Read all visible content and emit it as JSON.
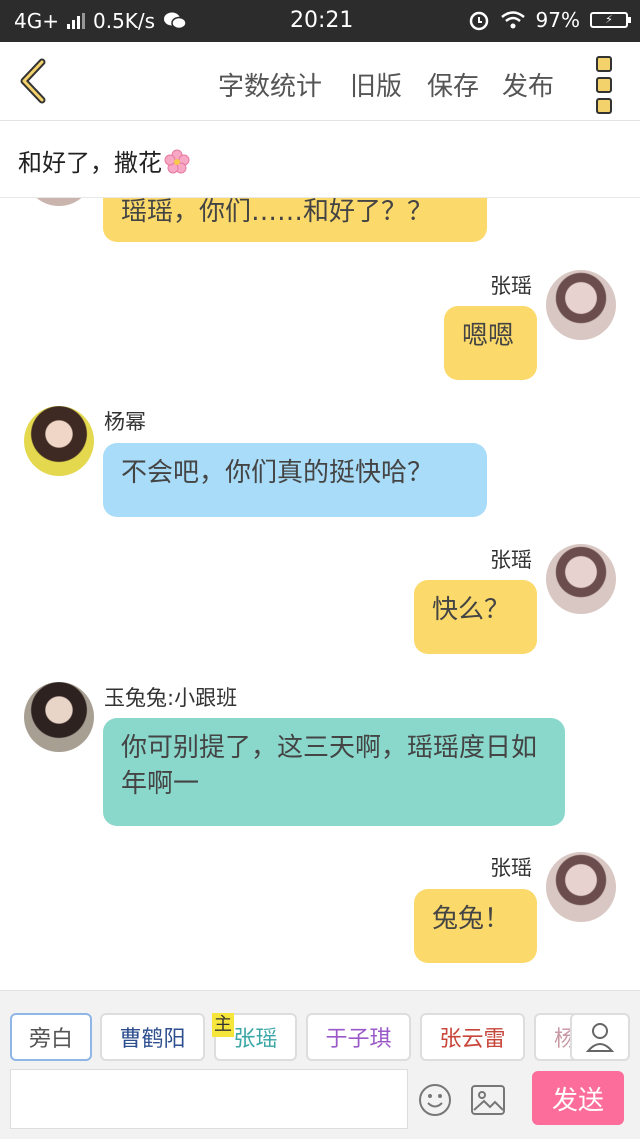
{
  "status": {
    "network": "4G+",
    "speed": "0.5K/s",
    "time": "20:21",
    "battery": "97%"
  },
  "toolbar": {
    "word_count": "字数统计",
    "old_version": "旧版",
    "save": "保存",
    "publish": "发布"
  },
  "title": "和好了，撒花",
  "messages": [
    {
      "side": "left",
      "name": "",
      "text": "瑶瑶，你们……和好了？？",
      "color": "yellow"
    },
    {
      "side": "right",
      "name": "张瑶",
      "text": "嗯嗯",
      "color": "yellow"
    },
    {
      "side": "left",
      "name": "杨幂",
      "text": "不会吧，你们真的挺快哈？",
      "color": "blue"
    },
    {
      "side": "right",
      "name": "张瑶",
      "text": "快么？",
      "color": "yellow"
    },
    {
      "side": "left",
      "name": "玉兔兔:小跟班",
      "text": "你可别提了，这三天啊，瑶瑶度日如年啊一",
      "color": "teal"
    },
    {
      "side": "right",
      "name": "张瑶",
      "text": "兔兔！",
      "color": "yellow"
    }
  ],
  "characters": [
    {
      "label": "旁白",
      "color": "#555555"
    },
    {
      "label": "曹鹤阳",
      "color": "#2d4f8f"
    },
    {
      "label": "张瑶",
      "color": "#3aa6a6",
      "badge": "主"
    },
    {
      "label": "于子琪",
      "color": "#9a58c8"
    },
    {
      "label": "张云雷",
      "color": "#c8453a"
    },
    {
      "label": "杨",
      "color": "#c89aa6"
    }
  ],
  "send_label": "发送",
  "colors": {
    "yellow": "#fbd96a",
    "blue": "#a9dcf8",
    "teal": "#8ad8cc",
    "send": "#fd6d9b"
  }
}
